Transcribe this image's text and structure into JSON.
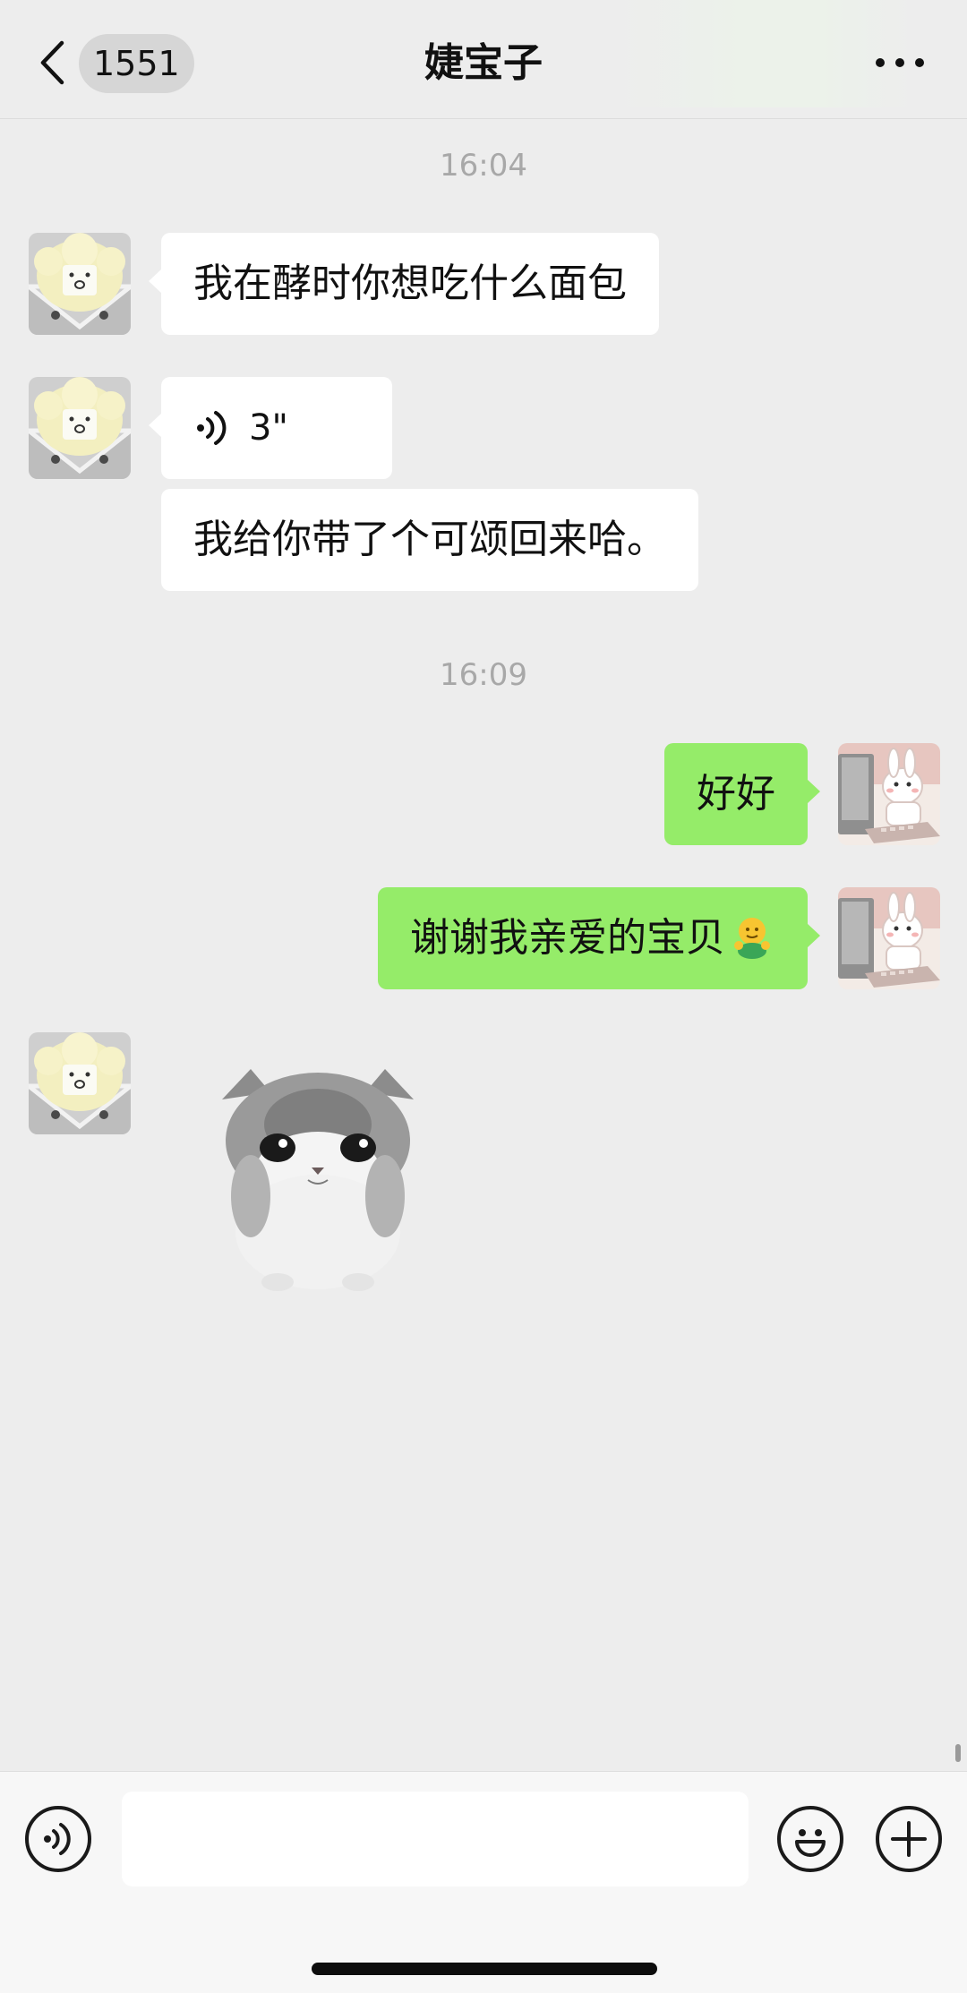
{
  "header": {
    "unread_count": "1551",
    "title": "婕宝子",
    "back_icon": "chevron-left-icon",
    "more_icon": "more-dots-icon"
  },
  "messages": [
    {
      "type": "timestamp",
      "text": "16:04"
    },
    {
      "type": "text",
      "direction": "incoming",
      "text": "我在酵时你想吃什么面包"
    },
    {
      "type": "voice",
      "direction": "incoming",
      "duration": "3\""
    },
    {
      "type": "text",
      "direction": "incoming",
      "text": "我给你带了个可颂回来哈。"
    },
    {
      "type": "timestamp",
      "text": "16:09"
    },
    {
      "type": "text",
      "direction": "outgoing",
      "text": "好好"
    },
    {
      "type": "text",
      "direction": "outgoing",
      "text": "谢谢我亲爱的宝贝",
      "emoji": "hug-emoji"
    },
    {
      "type": "sticker",
      "direction": "incoming",
      "sticker": "kitten-sticker"
    }
  ],
  "input": {
    "placeholder": "",
    "voice_icon": "voice-mode-icon",
    "emoji_icon": "emoji-face-icon",
    "plus_icon": "plus-icon"
  },
  "colors": {
    "background": "#ededed",
    "outgoing_bubble": "#95ec69",
    "incoming_bubble": "#ffffff",
    "timestamp": "#a8a8a8"
  }
}
